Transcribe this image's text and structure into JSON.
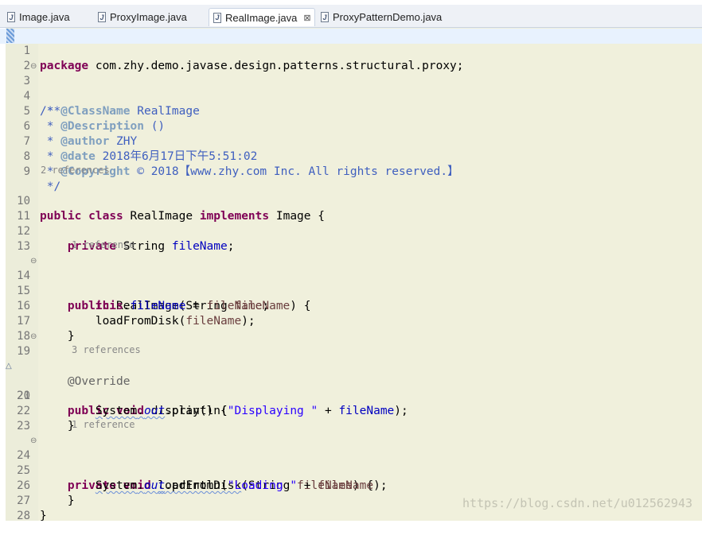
{
  "tabs": [
    {
      "label": "Image.java",
      "active": false
    },
    {
      "label": "ProxyImage.java",
      "active": false
    },
    {
      "label": "RealImage.java",
      "active": true
    },
    {
      "label": "ProxyPatternDemo.java",
      "active": false
    }
  ],
  "close_glyph": "⊠",
  "line_numbers": [
    "1",
    "2",
    "3",
    "4",
    "5",
    "6",
    "7",
    "8",
    "9",
    "10",
    "11",
    "12",
    "13",
    "14",
    "15",
    "16",
    "17",
    "18",
    "19",
    "20",
    "21",
    "22",
    "23",
    "24",
    "25",
    "26",
    "27",
    "28"
  ],
  "code": {
    "l1_kw": "package",
    "l1_rest": " com.zhy.demo.javase.design.patterns.structural.proxy;",
    "l3": "/**",
    "l4_pre": " * ",
    "l4_tag": "@ClassName",
    "l4_val": " RealImage",
    "l5_pre": " * ",
    "l5_tag": "@Description",
    "l5_val": " ()",
    "l6_pre": " * ",
    "l6_tag": "@author",
    "l6_val": " ZHY",
    "l7_pre": " * ",
    "l7_tag": "@date",
    "l7_val": " 2018年6月17日下午5:51:02",
    "l8_pre": " * ",
    "l8_tag": "@Copyright",
    "l8_val": " © 2018【www.zhy.com Inc. All rights reserved.】",
    "l9": " */",
    "l10_kw1": "public",
    "l10_kw2": "class",
    "l10_name": " RealImage ",
    "l10_kw3": "implements",
    "l10_rest": " Image {",
    "l12_kw": "private",
    "l12_type": " String ",
    "l12_field": "fileName",
    "l12_end": ";",
    "l14_kw": "public",
    "l14_rest": " RealImage(String ",
    "l14_param": "fileName",
    "l14_end": ") {",
    "l15_this": "this",
    "l15_dot": ".",
    "l15_field": "fileName",
    "l15_eq": " = ",
    "l15_param": "fileName",
    "l15_end": ";",
    "l16_call": "loadFromDisk(",
    "l16_param": "fileName",
    "l16_end": ");",
    "l17": "}",
    "l19": "@Override",
    "l20_kw1": "public",
    "l20_kw2": "void",
    "l20_rest": " display() {",
    "l21_sys": "System",
    "l21_dot": ".",
    "l21_out": "out",
    "l21_call": ".println(",
    "l21_str": "\"Displaying \"",
    "l21_plus": " + ",
    "l21_field": "fileName",
    "l21_end": ");",
    "l22": "}",
    "l24_kw1": "private",
    "l24_kw2": "void",
    "l24_name": "loadFromDisk",
    "l24_rest": "(String ",
    "l24_param": "fileName",
    "l24_end": ") {",
    "l25_sys": "System",
    "l25_dot": ".",
    "l25_out": "out",
    "l25_call": ".println(",
    "l25_str": "\"Loading \"",
    "l25_plus": " + ",
    "l25_param": "fileName",
    "l25_end": ");",
    "l26": "}",
    "l27": "}"
  },
  "annotations": {
    "class_refs": "2 references",
    "field_refs": "1 reference",
    "display_refs": "3 references",
    "load_refs": "1 reference"
  },
  "watermark": "https://blog.csdn.net/u012562943",
  "colors": {
    "keyword": "#7f0055",
    "javadoc": "#3f5fbf",
    "field": "#0000c0",
    "string": "#2a00ff",
    "editor_bg": "#f0f0dc"
  }
}
